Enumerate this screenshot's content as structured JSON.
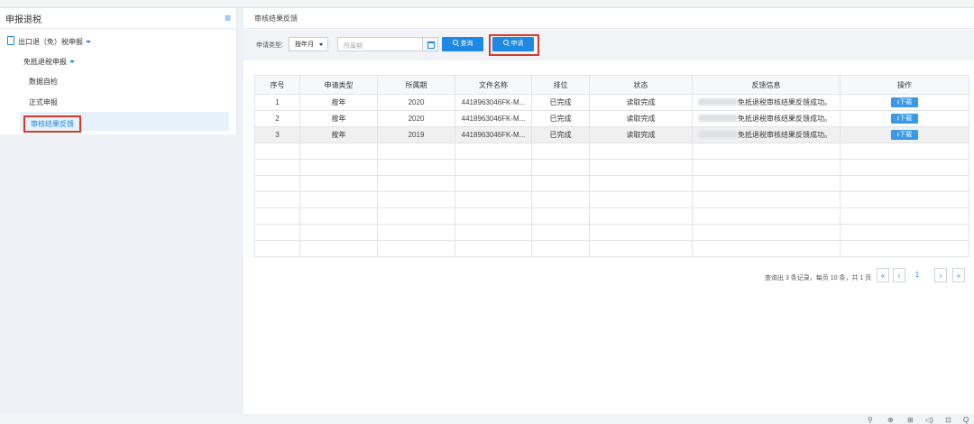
{
  "sidebar": {
    "title": "申报退税",
    "menu_icon": "hamburger-icon",
    "export_item": "出口退（免）税申报",
    "exempt_item": "免抵退税申报",
    "self_check": "数据自检",
    "formal": "正式申报",
    "feedback": "审核结果反馈"
  },
  "main": {
    "title": "审核结果反馈",
    "filter": {
      "type_label": "申请类型:",
      "type_value": "按年月",
      "period_placeholder": "所属期",
      "query_btn": "查询",
      "apply_btn": "申请"
    }
  },
  "table": {
    "headers": [
      "序号",
      "申请类型",
      "所属期",
      "文件名称",
      "排位",
      "状态",
      "反馈信息",
      "操作"
    ],
    "rows": [
      {
        "no": "1",
        "type": "按年",
        "period": "2020",
        "file": "4418963046FK-M...",
        "rank": "已完成",
        "status": "读取完成",
        "feedback": "免抵退税审核结果反馈成功。",
        "action": "下载"
      },
      {
        "no": "2",
        "type": "按年",
        "period": "2020",
        "file": "4418963046FK-M...",
        "rank": "已完成",
        "status": "读取完成",
        "feedback": "免抵退税审核结果反馈成功。",
        "action": "下载"
      },
      {
        "no": "3",
        "type": "按年",
        "period": "2019",
        "file": "4418963046FK-M...",
        "rank": "已完成",
        "status": "读取完成",
        "feedback": "免抵退税审核结果反馈成功。",
        "action": "下载"
      }
    ]
  },
  "pager": {
    "summary": "查询出 3 条记录，每页 10 条，共 1 页",
    "first": "«",
    "prev": "‹",
    "current": "1",
    "next": "›",
    "last": "»"
  },
  "tray": [
    "⚲",
    "⊕",
    "⊞",
    "◁)",
    "⊡",
    "Q"
  ],
  "colors": {
    "accent": "#1e88e5",
    "highlight": "#d9382b"
  }
}
